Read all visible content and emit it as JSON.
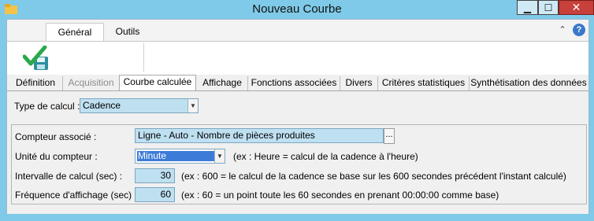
{
  "window": {
    "title": "Nouveau Courbe",
    "controls": {
      "minimize": "▁",
      "maximize": "☐",
      "close": "✕"
    }
  },
  "ribbon": {
    "tabs": [
      {
        "label": "Général"
      },
      {
        "label": "Outils"
      }
    ],
    "collapse_icon": "chevron-up-icon",
    "help_label": "?"
  },
  "tabs": [
    {
      "label": "Définition"
    },
    {
      "label": "Acquisition"
    },
    {
      "label": "Courbe calculée"
    },
    {
      "label": "Affichage"
    },
    {
      "label": "Fonctions associées"
    },
    {
      "label": "Divers"
    },
    {
      "label": "Critères statistiques"
    },
    {
      "label": "Synthétisation des données"
    }
  ],
  "form": {
    "calc_type": {
      "label": "Type de calcul :",
      "value": "Cadence"
    },
    "counter": {
      "label": "Compteur associé :",
      "value": "Ligne - Auto - Nombre de pièces produites",
      "button": "..."
    },
    "unit": {
      "label": "Unité du compteur :",
      "value": "Minute",
      "hint": "(ex : Heure = calcul de la cadence à l'heure)"
    },
    "interval": {
      "label": "Intervalle de calcul (sec) :",
      "value": "30",
      "hint": "(ex : 600 = le calcul de la cadence se base sur les 600 secondes précédent l'instant calculé)"
    },
    "frequency": {
      "label": "Fréquence d'affichage (sec) :",
      "value": "60",
      "hint": "(ex : 60 = un point toute les 60 secondes en prenant 00:00:00 comme base)"
    }
  }
}
